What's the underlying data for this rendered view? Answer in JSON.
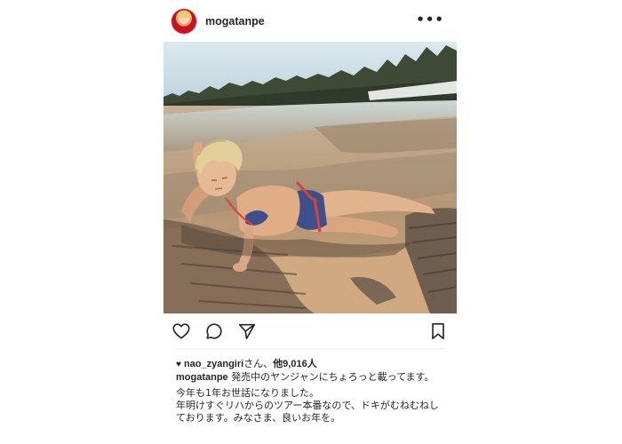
{
  "post": {
    "username": "mogatanpe",
    "more_icon": "more-horizontal-icon",
    "actions": {
      "like_icon": "heart-outline-icon",
      "comment_icon": "comment-bubble-icon",
      "share_icon": "paper-plane-icon",
      "save_icon": "bookmark-icon"
    },
    "likes": {
      "heart_glyph": "♥",
      "liker": "nao_zyangiri",
      "suffix": "さん、",
      "others": "他9,016人"
    },
    "caption": {
      "author": "mogatanpe",
      "line1": "発売中のヤンジャンにちょろっと載ってます。",
      "line2": "今年も1年お世話になりました。",
      "line3": "年明けすぐリハからのツアー本番なので、ドキがむねむねしております。みなさま、良いお年を。"
    }
  },
  "colors": {
    "text": "#262626",
    "divider": "#efefef",
    "border": "#e6e6e6"
  }
}
